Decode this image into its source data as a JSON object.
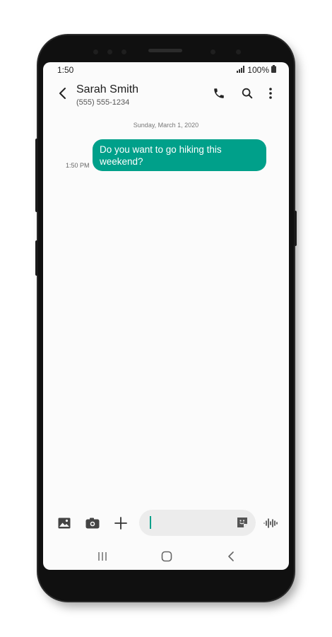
{
  "status": {
    "time": "1:50",
    "battery": "100%"
  },
  "conversation": {
    "name": "Sarah Smith",
    "number": "(555) 555-1234"
  },
  "thread": {
    "date_separator": "Sunday, March 1, 2020",
    "messages": [
      {
        "direction": "outgoing",
        "text": "Do you want to go hiking this weekend?",
        "time": "1:50 PM"
      }
    ]
  },
  "icons": {
    "header": [
      "back-arrow-icon",
      "phone-icon",
      "search-icon",
      "more-vert-icon"
    ],
    "composer": [
      "gallery-icon",
      "camera-icon",
      "plus-icon",
      "sticker-icon",
      "voice-icon"
    ],
    "navbar": [
      "recents-icon",
      "home-icon",
      "back-icon"
    ]
  },
  "colors": {
    "accent": "#00a08a",
    "bubble_text": "#ffffff"
  }
}
